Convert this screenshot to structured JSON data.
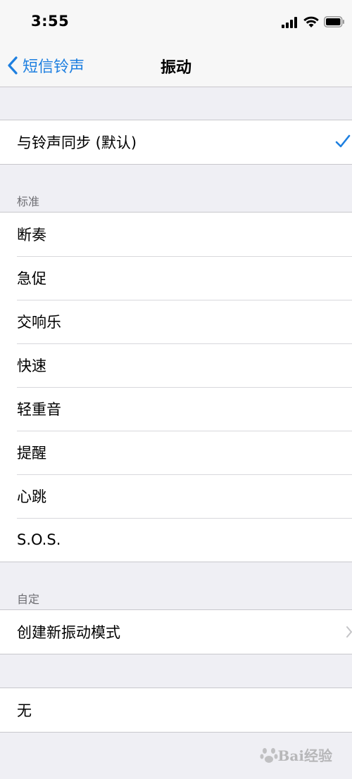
{
  "status_bar": {
    "time": "3:55"
  },
  "nav": {
    "back_label": "短信铃声",
    "title": "振动"
  },
  "sync_group": {
    "label": "与铃声同步 (默认)",
    "selected": true
  },
  "standard_section": {
    "header": "标准",
    "items": [
      "断奏",
      "急促",
      "交响乐",
      "快速",
      "轻重音",
      "提醒",
      "心跳",
      "S.O.S."
    ]
  },
  "custom_section": {
    "header": "自定",
    "create_label": "创建新振动模式"
  },
  "none_group": {
    "label": "无"
  },
  "colors": {
    "accent": "#1d7fe0",
    "background": "#efeff4",
    "separator": "#c8c7cc"
  },
  "watermark": {
    "text": "Bai经验"
  }
}
